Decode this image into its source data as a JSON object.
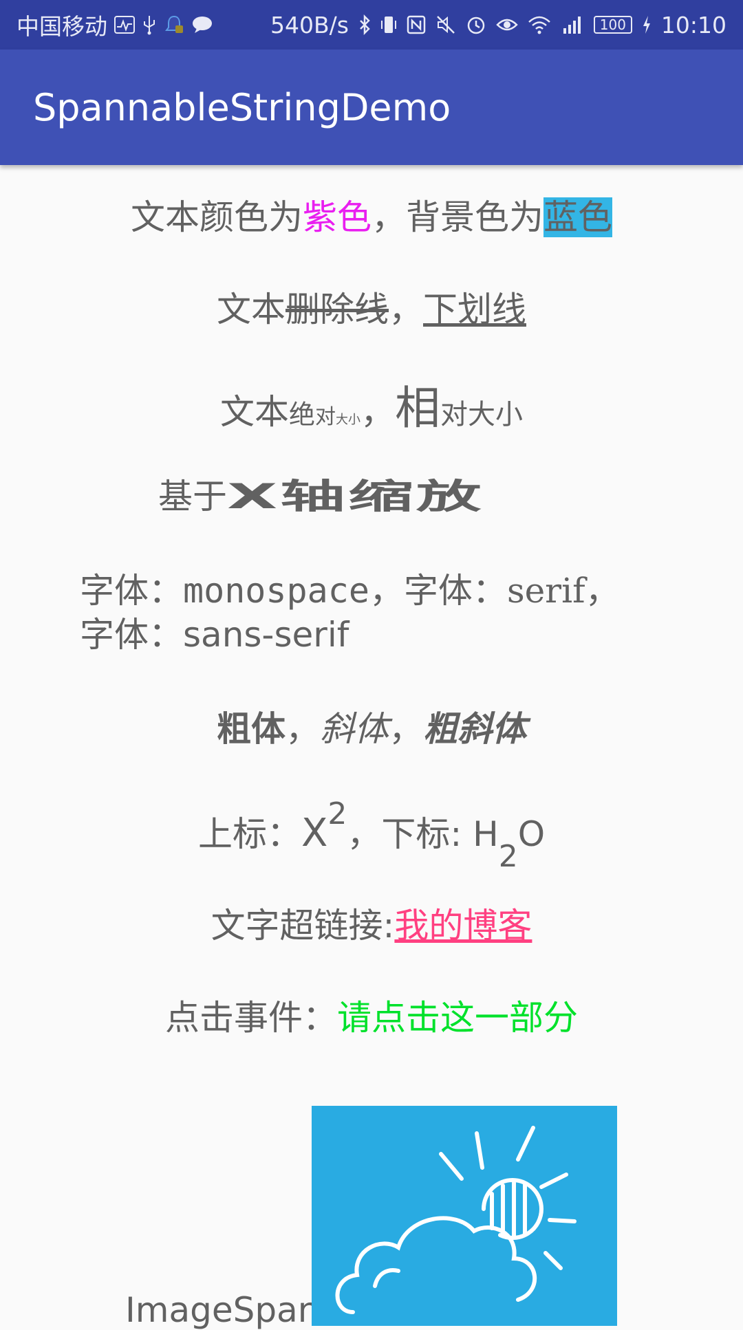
{
  "status_bar": {
    "carrier": "中国移动",
    "net_speed": "540B/s",
    "battery": "100",
    "time": "10:10",
    "icons": [
      "activity-icon",
      "usb-icon",
      "notification-icon",
      "message-icon",
      "bluetooth-icon",
      "vibrate-icon",
      "nfc-icon",
      "mute-icon",
      "alarm-icon",
      "eye-icon",
      "wifi-icon",
      "signal-4g-icon",
      "battery-icon",
      "charging-icon"
    ]
  },
  "app_bar": {
    "title": "SpannableStringDemo"
  },
  "lines": {
    "color": {
      "prefix": "文本颜色为",
      "purple": "紫色",
      "middle": "，背景色为",
      "blue": "蓝色"
    },
    "decoration": {
      "prefix": "文本",
      "strike": "删除线",
      "comma": "，",
      "underline": "下划线"
    },
    "size": {
      "prefix": "文本",
      "abs1": "绝",
      "abs2": "对",
      "abs3": "大小",
      "comma": "，",
      "rel1": "相",
      "rel2": "对大小"
    },
    "scale": {
      "prefix": "基于",
      "scaled": "X轴缩放"
    },
    "fonts": {
      "label1": "字体：",
      "mono": "monospace",
      "comma1": "，",
      "label2": "字体：",
      "serif": "serif",
      "comma2": "，",
      "label3": "字体：",
      "sans": "sans-serif"
    },
    "style": {
      "bold": "粗体",
      "comma1": "，",
      "italic": "斜体",
      "comma2": "，",
      "bold_italic": "粗斜体"
    },
    "script": {
      "sup_label": "上标：",
      "x": "X",
      "two_sup": "2",
      "comma": "，",
      "sub_label": "下标: ",
      "h": "H",
      "two_sub": "2",
      "o": "O"
    },
    "link": {
      "prefix": "文字超链接:",
      "link": "我的博客"
    },
    "click": {
      "prefix": "点击事件：",
      "clickable": "请点击这一部分"
    },
    "image": {
      "label": "ImageSpan"
    }
  },
  "colors": {
    "status_bar": "#303f9f",
    "app_bar": "#3f51b5",
    "purple": "#e91ef0",
    "blue_bg": "#33b5e5",
    "link": "#ff4081",
    "green": "#00e12b",
    "image_bg": "#29abe2"
  }
}
